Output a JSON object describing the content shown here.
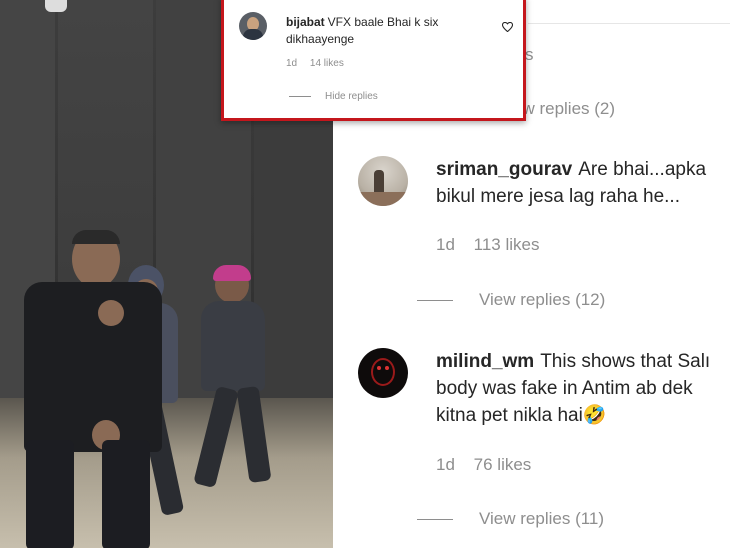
{
  "post": {
    "media_alt": "dance-rehearsal-video"
  },
  "comments_stub": {
    "replies_suffix": "s",
    "view_replies": "ew replies (2)"
  },
  "popup": {
    "username": "bijabat",
    "text": "VFX baale Bhai k six dikhaayenge",
    "time": "1d",
    "likes": "14 likes",
    "hide_replies": "Hide replies",
    "border_color": "#c4161c"
  },
  "comments": [
    {
      "username": "sriman_gourav",
      "text_line1": "Are bhai...apka",
      "text_line2": "bikul mere jesa lag raha he...",
      "time": "1d",
      "likes": "113 likes",
      "view_replies": "View replies (12)"
    },
    {
      "username": "milind_wm",
      "text_line1": "This shows that Salı",
      "text_line2": "body was fake in Antim ab dek",
      "text_line3": "kitna pet nikla hai🤣",
      "time": "1d",
      "likes": "76 likes",
      "view_replies": "View replies (11)"
    }
  ],
  "colors": {
    "text": "#262626",
    "secondary": "#8e8e8e"
  }
}
